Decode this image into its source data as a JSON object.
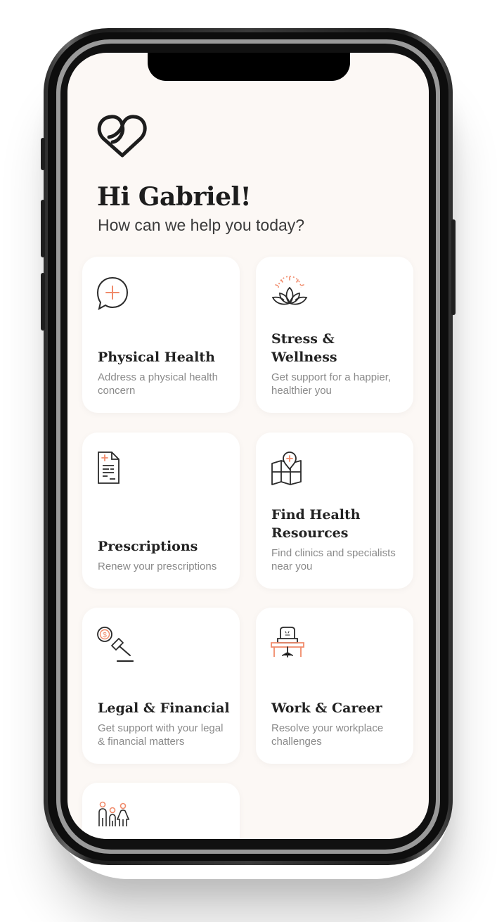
{
  "greeting": "Hi Gabriel!",
  "subtitle": "How can we help you today?",
  "cards": [
    {
      "title": "Physical Health",
      "desc": "Address a physical health concern",
      "icon": "chat-plus-icon"
    },
    {
      "title": "Stress & Wellness",
      "desc": "Get support for a happier, healthier you",
      "icon": "lotus-icon"
    },
    {
      "title": "Prescriptions",
      "desc": "Renew your prescriptions",
      "icon": "prescription-icon"
    },
    {
      "title": "Find Health Resources",
      "desc": "Find clinics and specialists near you",
      "icon": "map-pin-icon"
    },
    {
      "title": "Legal & Financial",
      "desc": "Get support with your legal & financial matters",
      "icon": "gavel-icon"
    },
    {
      "title": "Work & Career",
      "desc": "Resolve your workplace challenges",
      "icon": "office-chair-icon"
    },
    {
      "title": "",
      "desc": "",
      "icon": "family-icon"
    }
  ],
  "colors": {
    "accent": "#f08a6a",
    "ink": "#222222",
    "background": "#fcf8f5"
  }
}
